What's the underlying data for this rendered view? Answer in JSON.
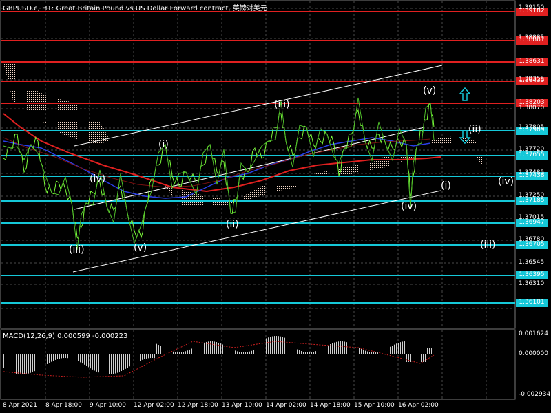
{
  "header": {
    "title": "GBPUSD.c, H1:  Great Britain Pound vs US Dollar Forward contract, 英镑对美元"
  },
  "macd": {
    "title": "MACD(12,26,9) 0.000599 -0.000223",
    "scale": [
      "0.001624",
      "0.000000",
      "-0.002934"
    ]
  },
  "price_scale": [
    "1.39150",
    "1.38885",
    "1.38355",
    "1.38070",
    "1.37805",
    "1.37720",
    "1.37485",
    "1.37250",
    "1.37015",
    "1.36780",
    "1.36545",
    "1.36310"
  ],
  "price_tags": [
    {
      "value": "1.39182",
      "color": "#e02020"
    },
    {
      "value": "1.38861",
      "color": "#e02020"
    },
    {
      "value": "1.38631",
      "color": "#e02020"
    },
    {
      "value": "1.38435",
      "color": "#e02020"
    },
    {
      "value": "1.38203",
      "color": "#e02020"
    },
    {
      "value": "1.37909",
      "color": "#15c8d8"
    },
    {
      "value": "1.37655",
      "color": "#15c8d8"
    },
    {
      "value": "1.37438",
      "color": "#15c8d8"
    },
    {
      "value": "1.37185",
      "color": "#15c8d8"
    },
    {
      "value": "1.36947",
      "color": "#15c8d8"
    },
    {
      "value": "1.36705",
      "color": "#15c8d8"
    },
    {
      "value": "1.36395",
      "color": "#15c8d8"
    },
    {
      "value": "1.36101",
      "color": "#15c8d8"
    }
  ],
  "time_scale": [
    "8 Apr 2021",
    "8 Apr 18:00",
    "9 Apr 10:00",
    "12 Apr 02:00",
    "12 Apr 18:00",
    "13 Apr 10:00",
    "14 Apr 02:00",
    "14 Apr 18:00",
    "15 Apr 10:00",
    "16 Apr 02:00"
  ],
  "wave_labels": [
    "(iii)",
    "(iv)",
    "(v)",
    "(i)",
    "(ii)",
    "(iii)",
    "(iv)",
    "(v)",
    "(ii)",
    "(iv)",
    "(i)",
    "(iii)"
  ],
  "colors": {
    "resistance": "#e02020",
    "support": "#15c8d8",
    "price": "#7cfc3a",
    "ma_slow": "#e02020",
    "ma_fast": "#2a3ee8",
    "cloud": "#f0d0c0",
    "grid": "#4a4a4a"
  },
  "icons": [
    "up-arrow-icon",
    "down-arrow-icon"
  ]
}
